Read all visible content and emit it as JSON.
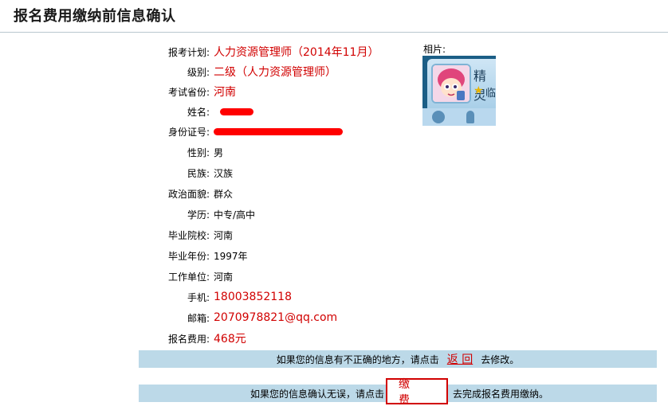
{
  "page": {
    "title": "报名费用缴纳前信息确认"
  },
  "info": [
    {
      "label": "报考计划:",
      "value": "人力资源管理师（2014年11月）",
      "style": "red"
    },
    {
      "label": "级别:",
      "value": "二级（人力资源管理师）",
      "style": "red"
    },
    {
      "label": "考试省份:",
      "value": "河南",
      "style": "red"
    },
    {
      "label": "姓名:",
      "value": "",
      "style": "redacted"
    },
    {
      "label": "身份证号:",
      "value": "",
      "style": "redacted"
    },
    {
      "label": "性别:",
      "value": "男",
      "style": "plain"
    },
    {
      "label": "民族:",
      "value": "汉族",
      "style": "plain"
    },
    {
      "label": "政治面貌:",
      "value": "群众",
      "style": "plain"
    },
    {
      "label": "学历:",
      "value": "中专/高中",
      "style": "plain"
    },
    {
      "label": "毕业院校:",
      "value": "河南",
      "style": "plain"
    },
    {
      "label": "毕业年份:",
      "value": "1997年",
      "style": "plain"
    },
    {
      "label": "工作单位:",
      "value": "河南",
      "style": "plain"
    },
    {
      "label": "手机:",
      "value": "18003852118",
      "style": "red"
    },
    {
      "label": "邮箱:",
      "value": "2070978821@qq.com",
      "style": "red"
    },
    {
      "label": "报名费用:",
      "value": "468元",
      "style": "red"
    }
  ],
  "photo": {
    "label": "相片:",
    "glyph": "精灵",
    "glyph2": "临"
  },
  "notice1": {
    "before": "如果您的信息有不正确的地方，请点击",
    "link": "返 回",
    "after": "去修改。"
  },
  "notice2": {
    "before": "如果您的信息确认无误，请点击",
    "button": "缴 费",
    "after": "去完成报名费用缴纳。"
  },
  "colors": {
    "accent_red": "#d10000",
    "bar_blue": "#bcd9e8",
    "redaction": "#ff0000"
  }
}
